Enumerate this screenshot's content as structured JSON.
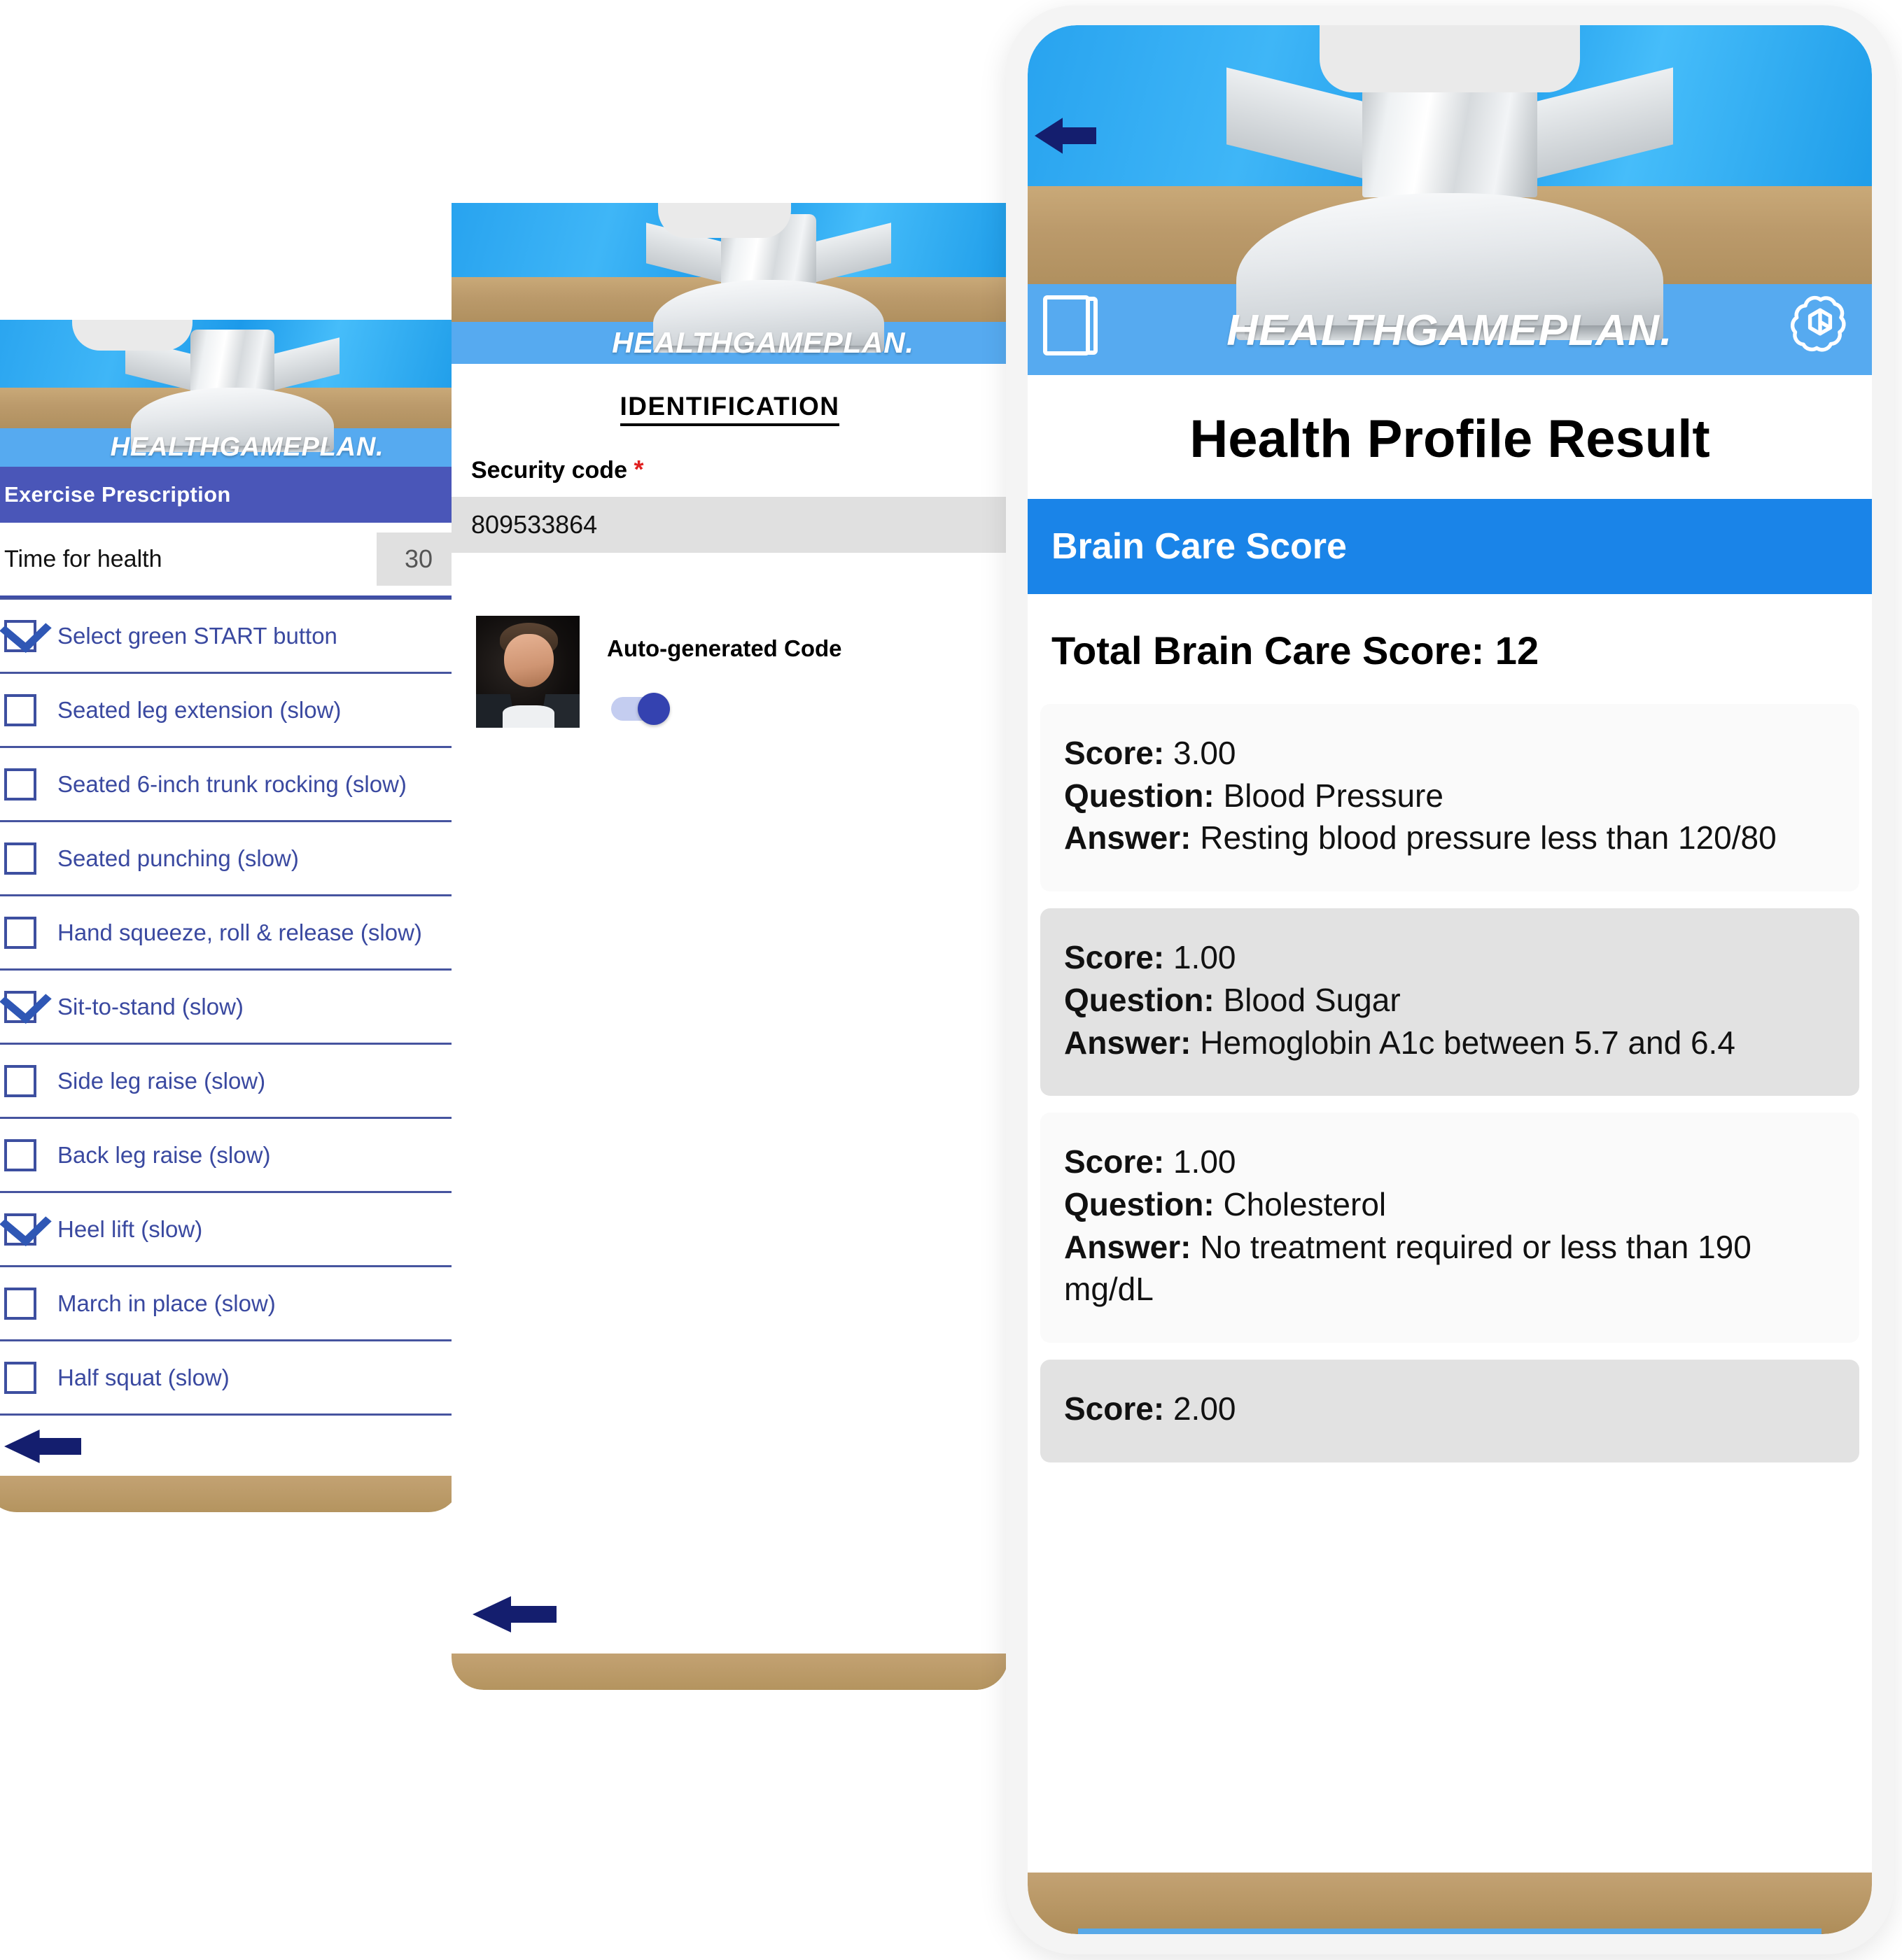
{
  "brand": {
    "wordmark": "HEALTHGAMEPLAN."
  },
  "left_phone": {
    "section_title": "Exercise Prescription",
    "meta_row": {
      "label": "Time for health",
      "value": "30"
    },
    "exercises": [
      {
        "label": "Select green START button",
        "checked": true
      },
      {
        "label": "Seated leg extension (slow)",
        "checked": false
      },
      {
        "label": "Seated 6-inch trunk rocking (slow)",
        "checked": false
      },
      {
        "label": "Seated punching (slow)",
        "checked": false
      },
      {
        "label": "Hand squeeze, roll & release (slow)",
        "checked": false
      },
      {
        "label": "Sit-to-stand (slow)",
        "checked": true
      },
      {
        "label": "Side leg raise (slow)",
        "checked": false
      },
      {
        "label": "Back leg raise (slow)",
        "checked": false
      },
      {
        "label": "Heel lift (slow)",
        "checked": true
      },
      {
        "label": "March in place (slow)",
        "checked": false
      },
      {
        "label": "Half squat (slow)",
        "checked": false
      }
    ]
  },
  "mid_phone": {
    "page_title": "IDENTIFICATION",
    "security_code": {
      "label": "Security code",
      "required_mark": "*",
      "value": "809533864"
    },
    "auto_code": {
      "label": "Auto-generated Code",
      "enabled": true
    }
  },
  "right_phone": {
    "page_title": "Health Profile Result",
    "band_label": "Brain Care Score",
    "total_line": "Total Brain Care Score: 12",
    "labels": {
      "score": "Score:",
      "question": "Question:",
      "answer": "Answer:"
    },
    "results": [
      {
        "score": "3.00",
        "question": "Blood Pressure",
        "answer": "Resting blood pressure less than 120/80"
      },
      {
        "score": "1.00",
        "question": "Blood Sugar",
        "answer": "Hemoglobin A1c between 5.7 and 6.4"
      },
      {
        "score": "1.00",
        "question": "Cholesterol",
        "answer": "No treatment required or less than 190 mg/dL"
      },
      {
        "score": "2.00",
        "question": "",
        "answer": ""
      }
    ]
  },
  "colors": {
    "brand_blue": "#56aaf0",
    "band_blue": "#1a84e8",
    "list_indigo": "#3a49a0",
    "header_indigo": "#4a56b8",
    "arrow_navy": "#141e6e",
    "toggle_on": "#3442b0"
  }
}
